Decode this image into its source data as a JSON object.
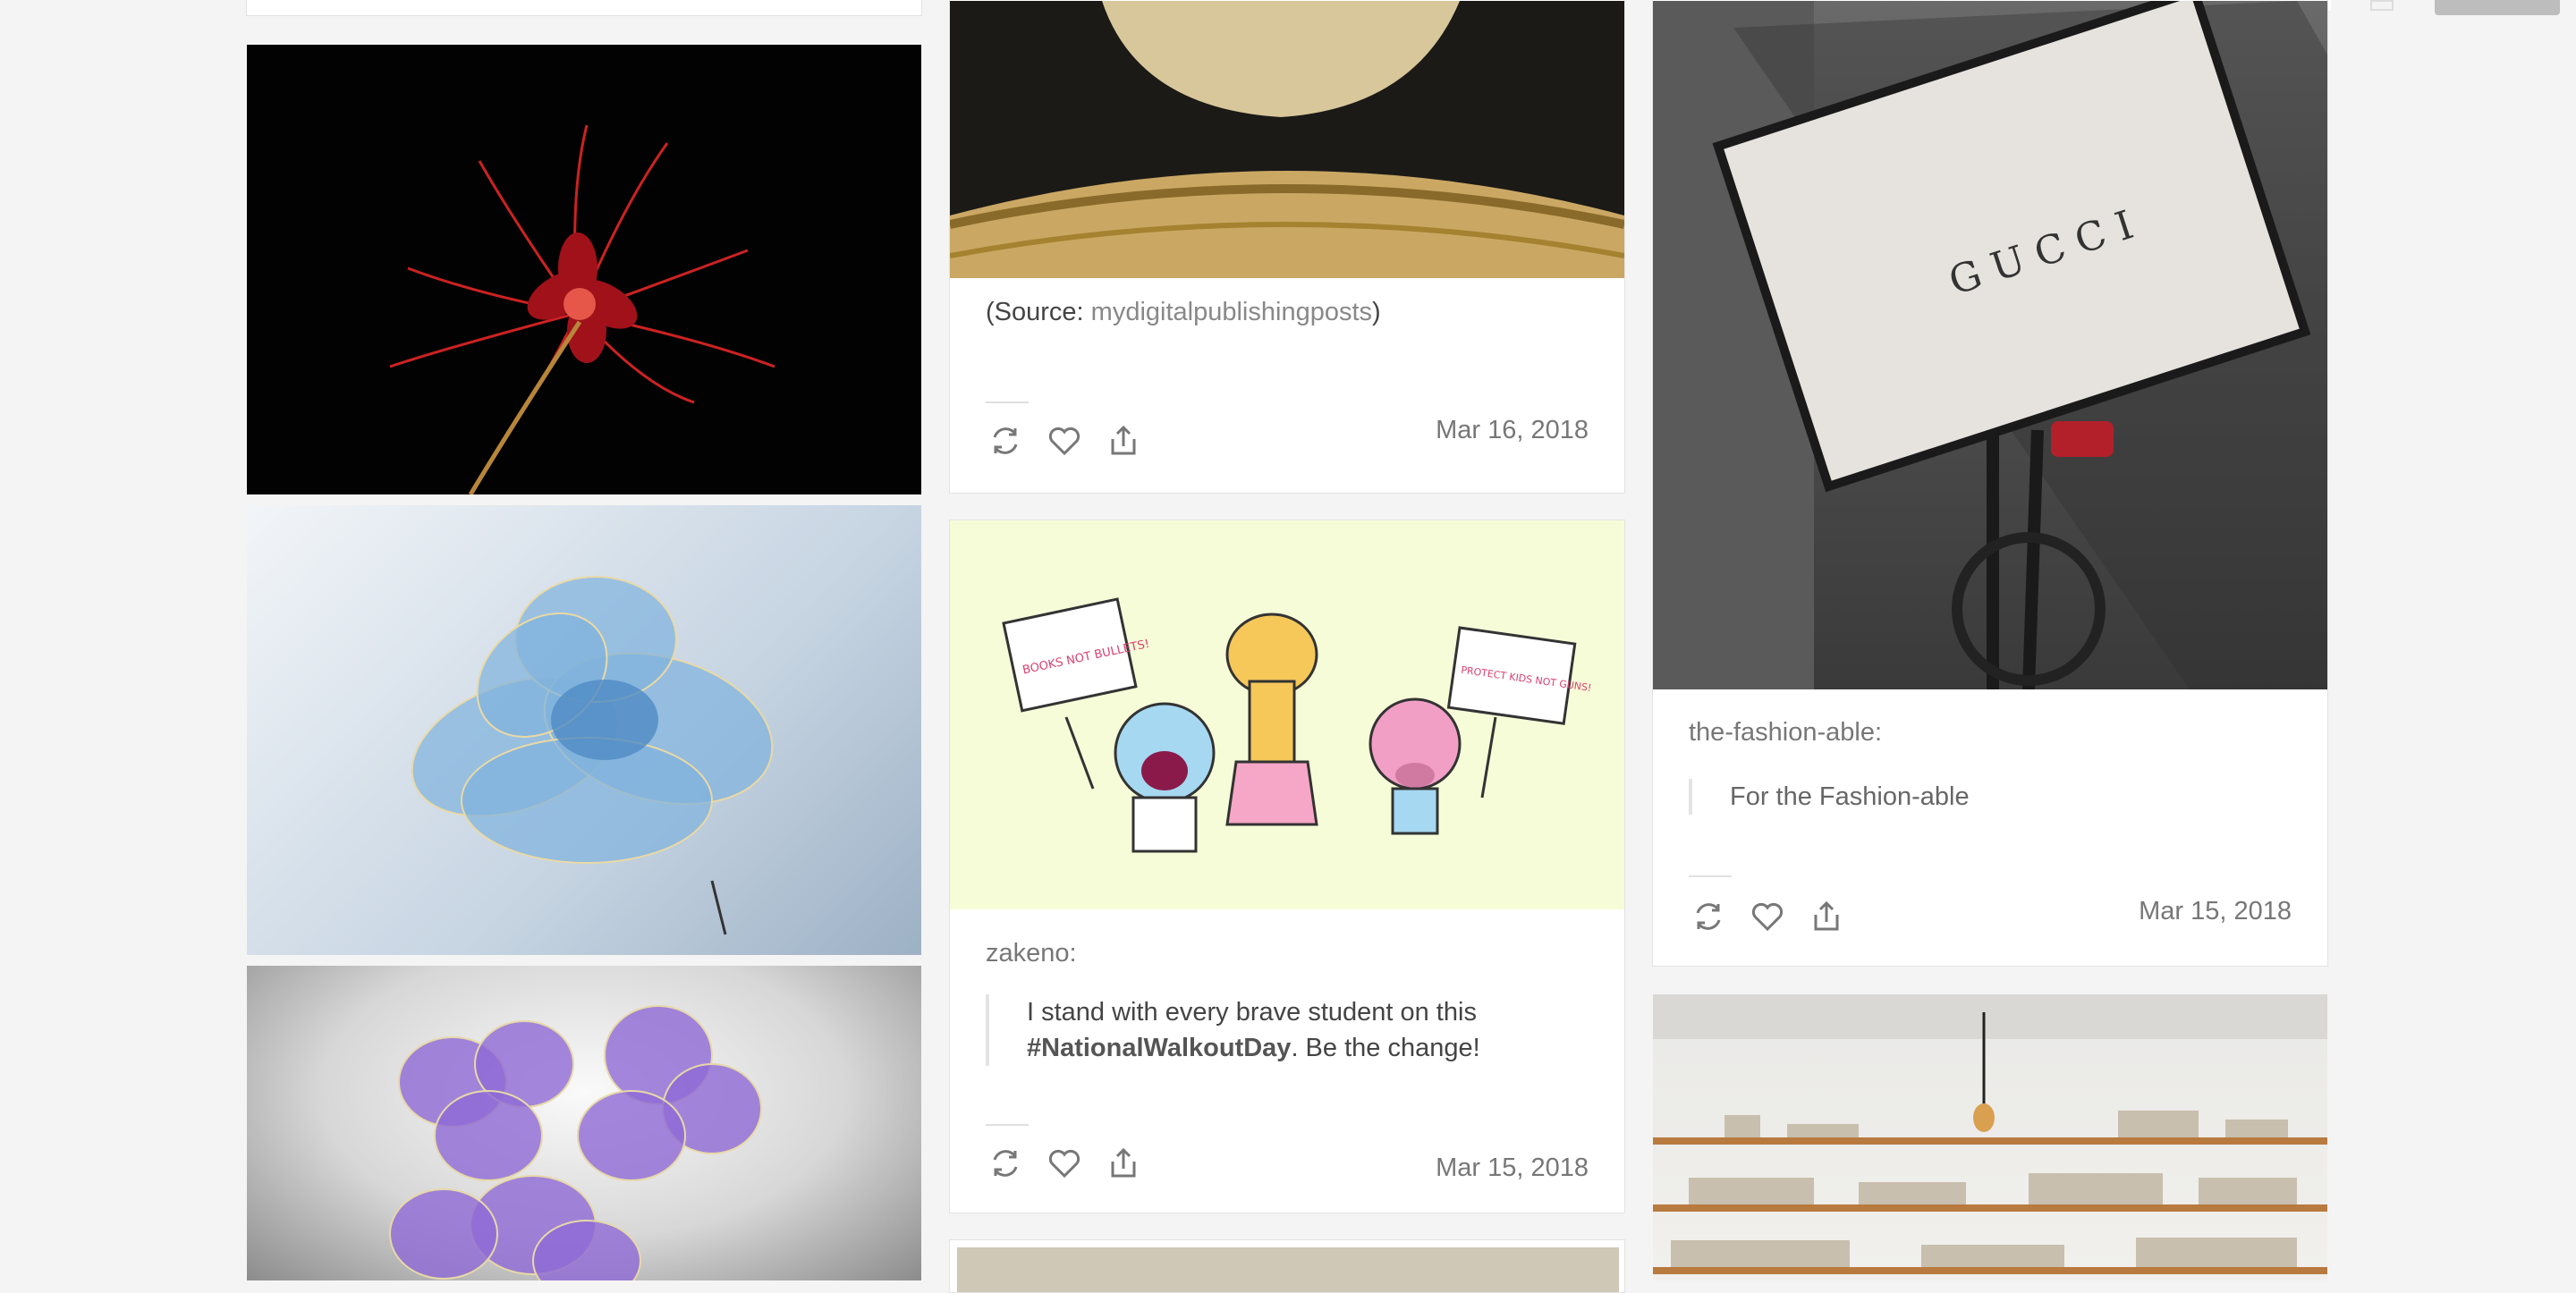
{
  "colors": {
    "background": "#f4f4f4",
    "card": "#ffffff",
    "text": "#444444",
    "muted": "#777777"
  },
  "posts": {
    "source_post": {
      "source_prefix": "(Source: ",
      "source_link": "mydigitalpublishingposts",
      "source_suffix": ")",
      "date": "Mar 16, 2018"
    },
    "zakeno_post": {
      "author": "zakeno:",
      "quote_line1": "I stand with every brave student on this",
      "hashtag": "#NationalWalkoutDay",
      "quote_rest": ". Be the change!",
      "date": "Mar 15, 2018",
      "sign_left": "BOOKS NOT BULLETS!",
      "sign_right": "PROTECT KIDS NOT GUNS!"
    },
    "fashion_post": {
      "author": "the-fashion-able:",
      "quote": "For the Fashion-able",
      "date": "Mar 15, 2018",
      "bag_brand": "GUCCI"
    }
  },
  "icons": {
    "reblog": "reblog-icon",
    "like": "heart-icon",
    "share": "share-icon"
  }
}
